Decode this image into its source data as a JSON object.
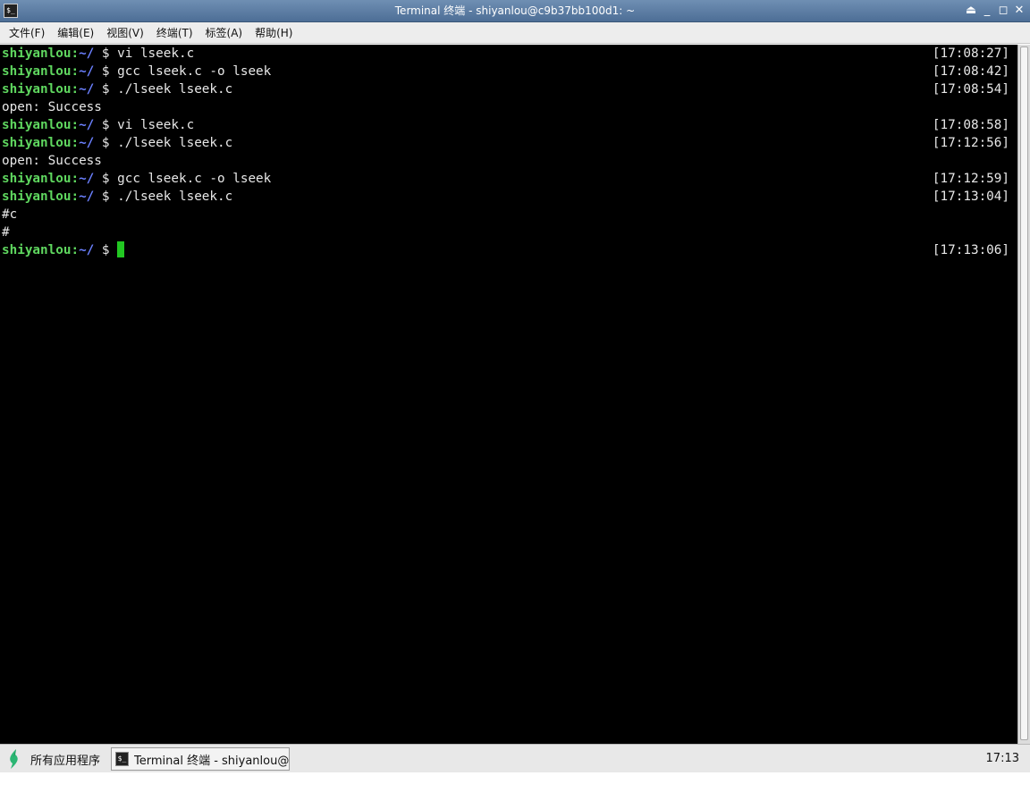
{
  "window": {
    "title": "Terminal 终端 - shiyanlou@c9b37bb100d1: ~",
    "app_icon_glyph": "$_",
    "controls": [
      "⏏",
      "_",
      "◻",
      "✕"
    ]
  },
  "menu": [
    {
      "label": "文件(F)"
    },
    {
      "label": "编辑(E)"
    },
    {
      "label": "视图(V)"
    },
    {
      "label": "终端(T)"
    },
    {
      "label": "标签(A)"
    },
    {
      "label": "帮助(H)"
    }
  ],
  "terminal": {
    "colors": {
      "user": "#5fd75f",
      "path": "#6b80ff",
      "text": "#e8e8e8",
      "background": "#000000",
      "cursor": "#22c722"
    },
    "prompt": {
      "user": "shiyanlou",
      "sep": ":",
      "path": "~/",
      "symbol": " $ "
    },
    "lines": [
      {
        "type": "cmd",
        "command": "vi lseek.c",
        "time": "[17:08:27]"
      },
      {
        "type": "cmd",
        "command": "gcc lseek.c -o lseek",
        "time": "[17:08:42]"
      },
      {
        "type": "cmd",
        "command": "./lseek lseek.c",
        "time": "[17:08:54]"
      },
      {
        "type": "out",
        "text": "open: Success"
      },
      {
        "type": "cmd",
        "command": "vi lseek.c",
        "time": "[17:08:58]"
      },
      {
        "type": "cmd",
        "command": "./lseek lseek.c",
        "time": "[17:12:56]"
      },
      {
        "type": "out",
        "text": "open: Success"
      },
      {
        "type": "cmd",
        "command": "gcc lseek.c -o lseek",
        "time": "[17:12:59]"
      },
      {
        "type": "cmd",
        "command": "./lseek lseek.c",
        "time": "[17:13:04]"
      },
      {
        "type": "out",
        "text": "#c"
      },
      {
        "type": "out",
        "text": "#"
      },
      {
        "type": "cmd",
        "command": "",
        "time": "[17:13:06]",
        "cursor": true
      }
    ]
  },
  "taskbar": {
    "start_label": "所有应用程序",
    "task_label": "Terminal 终端 - shiyanlou@…",
    "task_icon_glyph": "$_",
    "clock": "17:13"
  }
}
